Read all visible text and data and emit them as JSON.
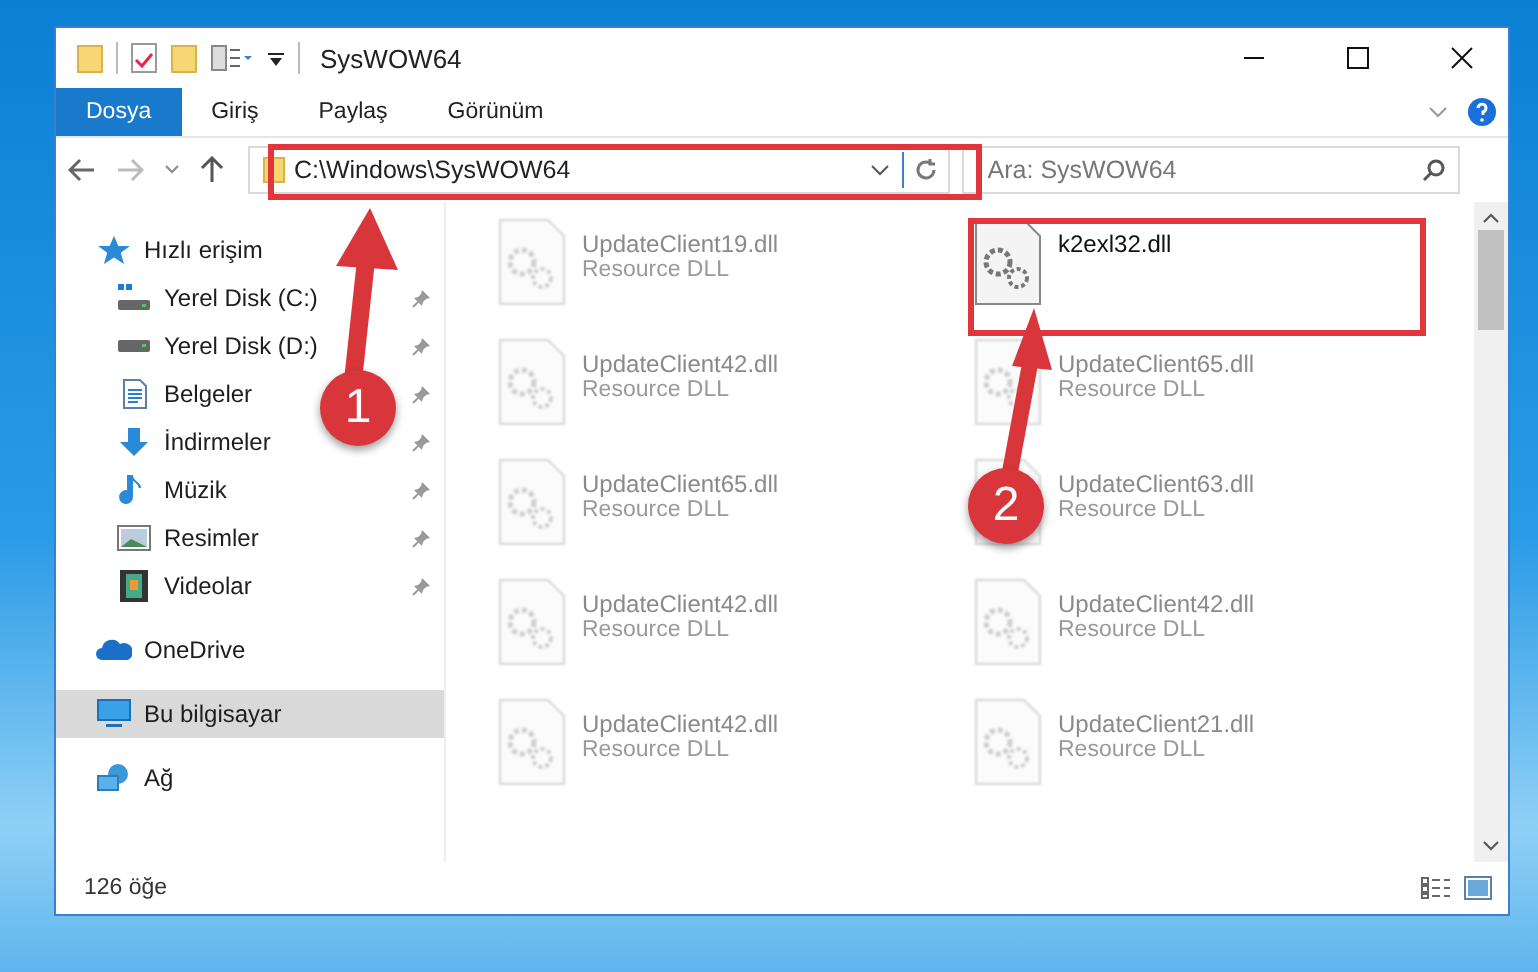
{
  "window": {
    "title": "SysWOW64"
  },
  "ribbon_tabs": [
    {
      "label": "Dosya",
      "selected": true
    },
    {
      "label": "Giriş",
      "selected": false
    },
    {
      "label": "Paylaş",
      "selected": false
    },
    {
      "label": "Görünüm",
      "selected": false
    }
  ],
  "address_bar": {
    "path": "C:\\Windows\\SysWOW64"
  },
  "search": {
    "placeholder": "Ara: SysWOW64"
  },
  "sidebar": {
    "items": [
      {
        "label": "Hızlı erişim",
        "kind": "star",
        "selected": false,
        "children": [
          {
            "label": "Yerel Disk (C:)",
            "kind": "systemdrive",
            "pinned": true,
            "selected": false
          },
          {
            "label": "Yerel Disk (D:)",
            "kind": "drive",
            "pinned": true,
            "selected": false
          },
          {
            "label": "Belgeler",
            "kind": "documents",
            "pinned": true,
            "selected": false
          },
          {
            "label": "İndirmeler",
            "kind": "downloads",
            "pinned": true,
            "selected": false
          },
          {
            "label": "Müzik",
            "kind": "music",
            "pinned": true,
            "selected": false
          },
          {
            "label": "Resimler",
            "kind": "pictures",
            "pinned": true,
            "selected": false
          },
          {
            "label": "Videolar",
            "kind": "videos",
            "pinned": true,
            "selected": false
          }
        ]
      },
      {
        "label": "OneDrive",
        "kind": "cloud",
        "selected": false
      },
      {
        "label": "Bu bilgisayar",
        "kind": "computer",
        "selected": true
      },
      {
        "label": "Ağ",
        "kind": "network",
        "selected": false
      }
    ]
  },
  "files": [
    {
      "name": "UpdateClient19.dll",
      "type": "Resource DLL",
      "blurred": true
    },
    {
      "name": "k2exl32.dll",
      "blurred": false
    },
    {
      "name": "UpdateClient42.dll",
      "type": "Resource DLL",
      "blurred": true
    },
    {
      "name": "UpdateClient65.dll",
      "type": "Resource DLL",
      "blurred": true
    },
    {
      "name": "UpdateClient65.dll",
      "type": "Resource DLL",
      "blurred": true
    },
    {
      "name": "UpdateClient63.dll",
      "type": "Resource DLL",
      "blurred": true
    },
    {
      "name": "UpdateClient42.dll",
      "type": "Resource DLL",
      "blurred": true
    },
    {
      "name": "UpdateClient42.dll",
      "type": "Resource DLL",
      "blurred": true
    },
    {
      "name": "UpdateClient42.dll",
      "type": "Resource DLL",
      "blurred": true
    },
    {
      "name": "UpdateClient21.dll",
      "type": "Resource DLL",
      "blurred": true
    }
  ],
  "status_bar": {
    "item_count": "126 öğe"
  },
  "annotations": [
    {
      "label": "1"
    },
    {
      "label": "2"
    }
  ]
}
